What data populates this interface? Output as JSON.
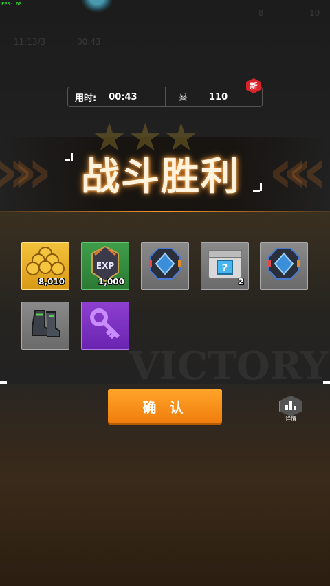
{
  "debug": {
    "fps": "FPS: 60"
  },
  "background_ghost": {
    "left1": "11:13/3",
    "left2": "00:43",
    "right1": "8",
    "right2": "10"
  },
  "stats": {
    "time_label": "用时:",
    "time_value": "00:43",
    "kills_value": "110",
    "new_badge": "新",
    "skull_icon": "skull-icon"
  },
  "banner": {
    "title": "战斗胜利",
    "stars": 3,
    "watermark": "VICTORY"
  },
  "rewards": [
    {
      "icon": "gold-coins-icon",
      "count": "8,010",
      "rarity": "gold"
    },
    {
      "icon": "exp-badge-icon",
      "count": "1,000",
      "rarity": "green"
    },
    {
      "icon": "blue-core-chip-icon",
      "count": "",
      "rarity": "gray"
    },
    {
      "icon": "mystery-chest-icon",
      "count": "2",
      "rarity": "gray"
    },
    {
      "icon": "blue-core-chip-icon",
      "count": "",
      "rarity": "gray"
    },
    {
      "icon": "combat-boots-icon",
      "count": "",
      "rarity": "gray"
    },
    {
      "icon": "purple-key-icon",
      "count": "",
      "rarity": "purple"
    }
  ],
  "buttons": {
    "confirm": "确 认",
    "details": "详情"
  },
  "colors": {
    "accent": "#f08a1a",
    "gold": "#f4c23b",
    "green": "#3f9e4a",
    "purple": "#8e3fd0",
    "badge_red": "#d8252b"
  }
}
